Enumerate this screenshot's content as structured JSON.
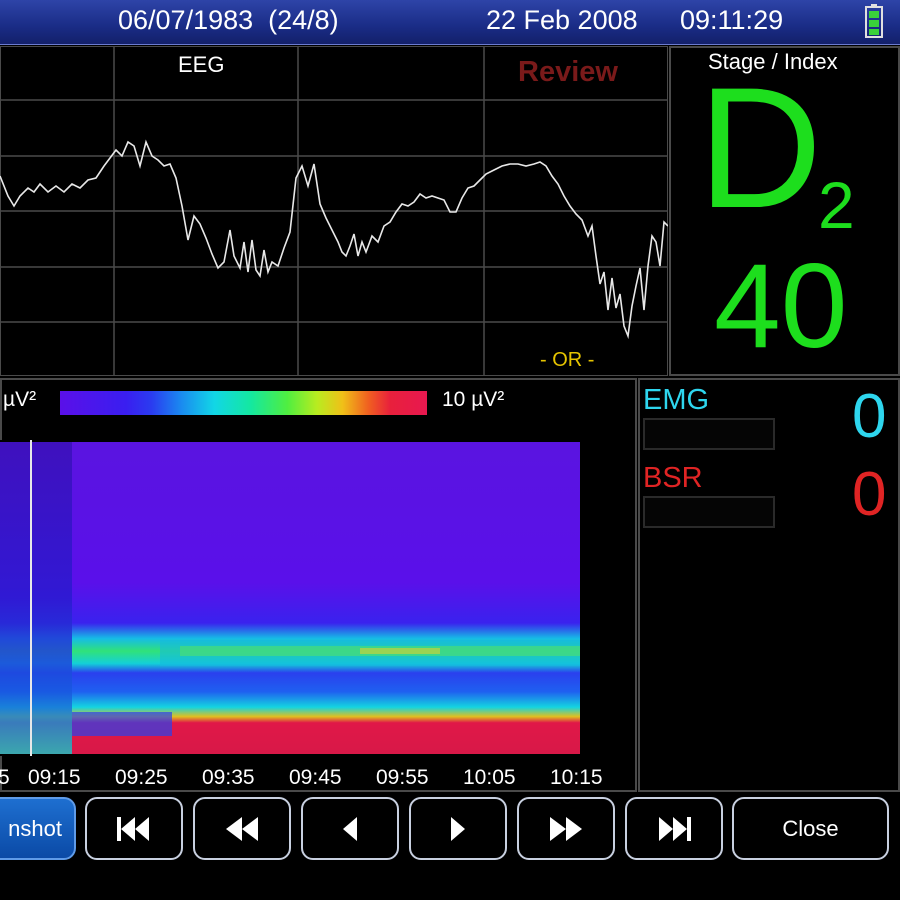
{
  "header": {
    "birth_date": "06/07/1983  (24/8)",
    "date": "22 Feb 2008",
    "time": "09:11:29",
    "battery_icon": "battery-icon",
    "background_color": "#1a2c86"
  },
  "eeg": {
    "label": "EEG",
    "mode": "Review",
    "or_label": "- OR -",
    "trace_color": "#ffffff"
  },
  "stage": {
    "title": "Stage / Index",
    "letter": "D",
    "subscript": "2",
    "index": "40",
    "color": "#1dde1d"
  },
  "spectrogram": {
    "scale_min": "µV²",
    "scale_max": "10 µV²",
    "time_ticks": [
      "5",
      "09:15",
      "09:25",
      "09:35",
      "09:45",
      "09:55",
      "10:05",
      "10:15"
    ]
  },
  "indicators": {
    "emg_label": "EMG",
    "emg_value": "0",
    "emg_color": "#2ed6ee",
    "bsr_label": "BSR",
    "bsr_value": "0",
    "bsr_color": "#e02424"
  },
  "toolbar": {
    "screenshot_label": "nshot",
    "close_label": "Close",
    "icons": [
      "skip-to-start-icon",
      "rewind-icon",
      "step-back-icon",
      "play-icon",
      "fast-forward-icon",
      "skip-to-end-icon"
    ]
  }
}
